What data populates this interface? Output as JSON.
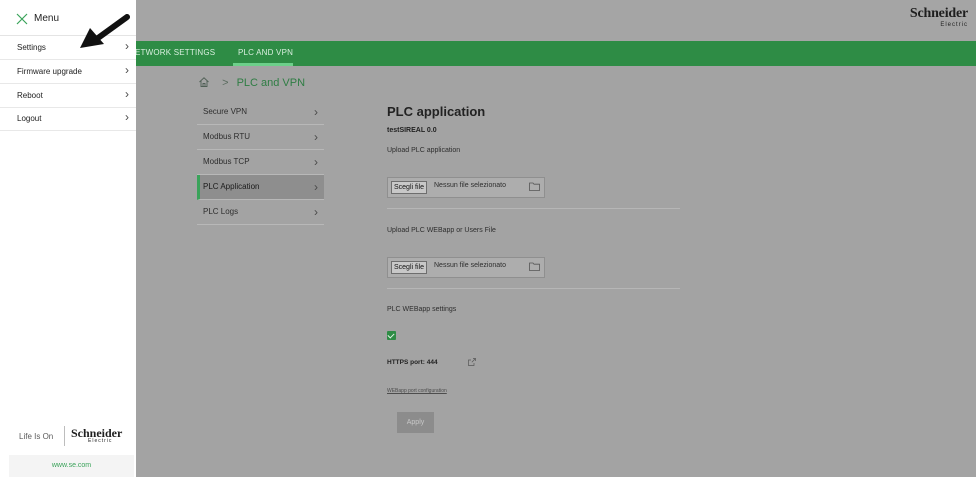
{
  "brand": {
    "name": "Schneider",
    "sub": "Electric",
    "tagline": "Life Is On",
    "website": "www.se.com"
  },
  "topnav": {
    "items": [
      "ETWORK SETTINGS",
      "PLC AND VPN"
    ]
  },
  "breadcrumb": {
    "current": "PLC and VPN"
  },
  "subnav": [
    {
      "label": "Secure VPN"
    },
    {
      "label": "Modbus RTU"
    },
    {
      "label": "Modbus TCP"
    },
    {
      "label": "PLC Application",
      "active": true
    },
    {
      "label": "PLC Logs"
    }
  ],
  "panel": {
    "title": "PLC application",
    "version": "testSIREAL 0.0",
    "upload_plc_label": "Upload PLC application",
    "upload_webapp_label": "Upload PLC WEBapp or Users File",
    "file_button": "Scegli file",
    "file_none": "Nessun file selezionato",
    "webapp_settings_label": "PLC WEBapp settings",
    "webapp_enabled": true,
    "https_port": "HTTPS port: 444",
    "port_config_link": "WEBapp port configuration",
    "apply_label": "Apply"
  },
  "menu": {
    "title": "Menu",
    "items": [
      {
        "label": "Settings"
      },
      {
        "label": "Firmware upgrade"
      },
      {
        "label": "Reboot"
      },
      {
        "label": "Logout"
      }
    ]
  },
  "colors": {
    "accent": "#3aa35a",
    "nav": "#2e8c45"
  },
  "icons": {
    "close": "close-icon",
    "home": "home-icon",
    "chevron": "chevron-right-icon",
    "folder": "folder-icon",
    "external": "external-link-icon",
    "pointer": "arrow-pointer-icon"
  }
}
